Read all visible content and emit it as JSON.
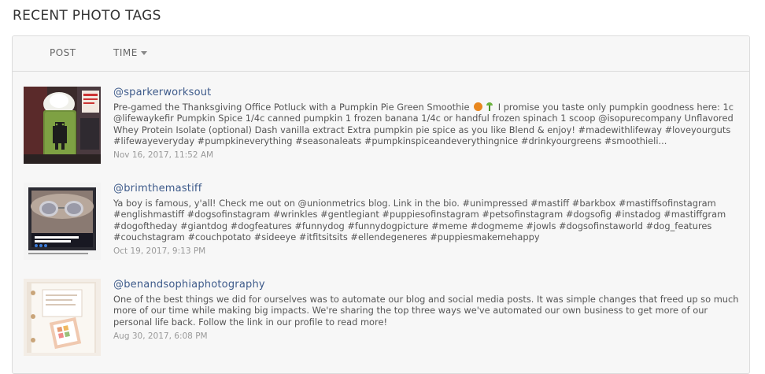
{
  "page": {
    "title": "RECENT PHOTO TAGS"
  },
  "table": {
    "columns": {
      "post": "POST",
      "time": "TIME"
    },
    "sort_icon": "caret-down-icon",
    "rows": [
      {
        "username": "@sparkerworksout",
        "caption_pre": "Pre-gamed the Thanksgiving Office Potluck with a Pumpkin Pie Green Smoothie",
        "emoji": [
          "pumpkin-emoji",
          "sprout-emoji"
        ],
        "caption_post": "I promise you taste only pumpkin goodness here: 1c @lifewaykefir Pumpkin Spice 1/4c canned pumpkin 1 frozen banana 1/4c or handful frozen spinach 1 scoop @isopurecompany Unflavored Whey Protein Isolate (optional) Dash vanilla extract Extra pumpkin pie spice as you like Blend & enjoy! #madewithlifeway #loveyourguts #lifewayeveryday #pumpkineverything #seasonaleats #pumpkinspiceandeverythingnice #drinkyourgreens #smoothieli...",
        "time": "Nov 16, 2017, 11:52 AM",
        "thumbnail": "green-smoothie-photo"
      },
      {
        "username": "@brimthemastiff",
        "caption": "Ya boy is famous, y'all! Check me out on @unionmetrics blog. Link in the bio. #unimpressed #mastiff #barkbox #mastiffsofinstagram #englishmastiff #dogsofinstagram #wrinkles #gentlegiant #puppiesofinstagram #petsofinstagram #dogsofig #instadog #mastiffgram #dogoftheday #giantdog #dogfeatures #funnydog #funnydogpicture #meme #dogmeme #jowls #dogsofinstaworld #dog_features #couchstagram #couchpotato #sideeye #itfitsitsits #ellendegeneres #puppiesmakemehappy",
        "time": "Oct 19, 2017, 9:13 PM",
        "thumbnail": "mastiff-blog-photo",
        "thumb_text": "What it's like when your blog is Instagram famous"
      },
      {
        "username": "@benandsophiaphotography",
        "caption": "One of the best things we did for ourselves was to automate our blog and social media posts. It was simple changes that freed up so much more of our time while making big impacts. We're sharing the top three ways we've automated our own business to get more of our personal life back. Follow the link in our profile to read more!",
        "time": "Aug 30, 2017, 6:08 PM",
        "thumbnail": "planner-binder-photo"
      }
    ]
  }
}
